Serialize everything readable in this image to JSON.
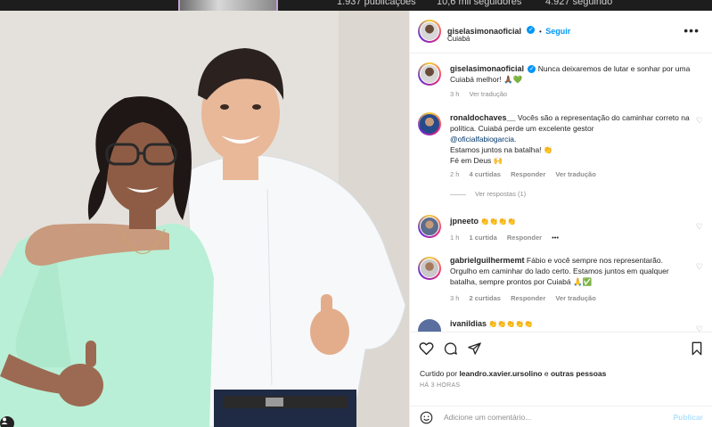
{
  "profile_stats": {
    "posts": "1.937 publicações",
    "followers": "10,6 mil seguidores",
    "following": "4.927 seguindo"
  },
  "post": {
    "author": "giselasimonaoficial",
    "follow_label": "Seguir",
    "separator": "•",
    "location": "Cuiabá",
    "more_label": "•••"
  },
  "caption": {
    "author": "giselasimonaoficial",
    "text": "Nunca deixaremos de lutar e sonhar por uma Cuiabá melhor! 🙏🏾💚",
    "time": "3 h",
    "translate": "Ver tradução"
  },
  "comments": [
    {
      "user": "ronaldochaves__",
      "text_before": "Vocês são a representação do caminhar correto na política. Cuiabá perde um excelente gestor",
      "mention": "@oficialfabiogarcia",
      "text_after_1": "Estamos juntos na batalha! 👏",
      "text_after_2": "Fé em Deus 🙌",
      "time": "2 h",
      "likes": "4 curtidas",
      "reply": "Responder",
      "translate": "Ver tradução",
      "view_replies": "Ver respostas (1)"
    },
    {
      "user": "jpneeto",
      "text": "👏👏👏👏",
      "time": "1 h",
      "likes": "1 curtida",
      "reply": "Responder",
      "more": "•••"
    },
    {
      "user": "gabrielguilhermemt",
      "text": "Fábio e você sempre nos representarão. Orgulho em caminhar do lado certo. Estamos juntos em qualquer batalha, sempre prontos por Cuiabá 🙏✅",
      "time": "3 h",
      "likes": "2 curtidas",
      "reply": "Responder",
      "translate": "Ver tradução"
    },
    {
      "user": "ivanildias",
      "text": "👏👏👏👏👏"
    }
  ],
  "likes_line": {
    "prefix": "Curtido por",
    "user": "leandro.xavier.ursolino",
    "middle": "e",
    "others": "outras pessoas"
  },
  "time_ago": "HÁ 3 HORAS",
  "add_comment": {
    "placeholder": "Adicione um comentário...",
    "publish": "Publicar"
  },
  "icons": {
    "verified": "verified-badge-icon",
    "like": "heart-icon",
    "comment": "comment-bubble-icon",
    "share": "paper-plane-icon",
    "save": "bookmark-icon",
    "emoji": "emoji-icon",
    "tagged": "user-tag-icon"
  },
  "colors": {
    "accent": "#0095f6",
    "muted": "#8e8e8e",
    "text": "#262626",
    "publish_disabled": "#b2dffc"
  }
}
